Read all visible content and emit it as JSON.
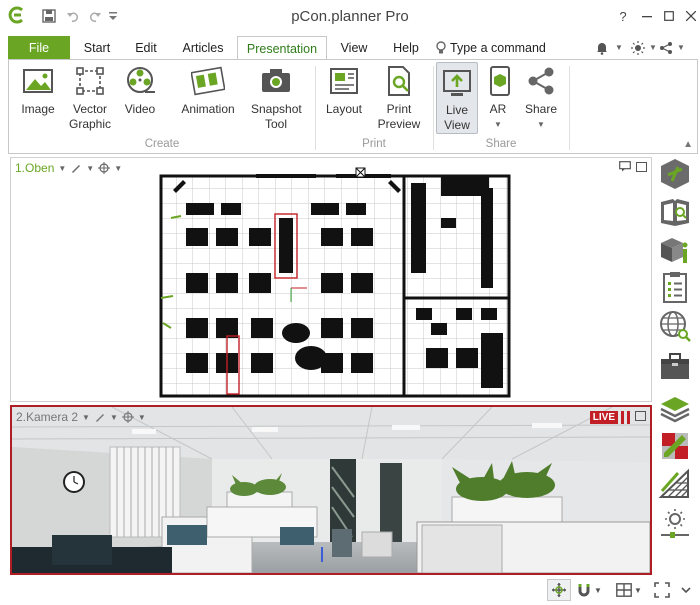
{
  "app": {
    "title": "pCon.planner Pro",
    "command_placeholder": "Type a command"
  },
  "tabs": [
    {
      "label": "File"
    },
    {
      "label": "Start"
    },
    {
      "label": "Edit"
    },
    {
      "label": "Articles"
    },
    {
      "label": "Presentation"
    },
    {
      "label": "View"
    },
    {
      "label": "Help"
    }
  ],
  "ribbon": {
    "create": {
      "label": "Create",
      "buttons": [
        {
          "label": "Image",
          "icon": "image-icon"
        },
        {
          "label": "Vector Graphic",
          "icon": "vector-graphic-icon"
        },
        {
          "label": "Video",
          "icon": "video-icon"
        },
        {
          "label": "Animation",
          "icon": "animation-icon"
        },
        {
          "label": "Snapshot Tool",
          "icon": "camera-icon"
        }
      ]
    },
    "print": {
      "label": "Print",
      "buttons": [
        {
          "label": "Layout",
          "icon": "layout-icon"
        },
        {
          "label": "Print Preview",
          "icon": "print-preview-icon"
        }
      ]
    },
    "share": {
      "label": "Share",
      "buttons": [
        {
          "label": "Live View",
          "icon": "live-view-icon",
          "active": true
        },
        {
          "label": "AR",
          "icon": "ar-icon"
        },
        {
          "label": "Share",
          "icon": "share-icon"
        }
      ]
    }
  },
  "viewports": {
    "top": {
      "label": "1.Oben"
    },
    "camera": {
      "label": "2.Kamera 2",
      "live_badge": "LIVE"
    }
  },
  "colors": {
    "accent": "#6aa624",
    "live": "#c21e25"
  }
}
